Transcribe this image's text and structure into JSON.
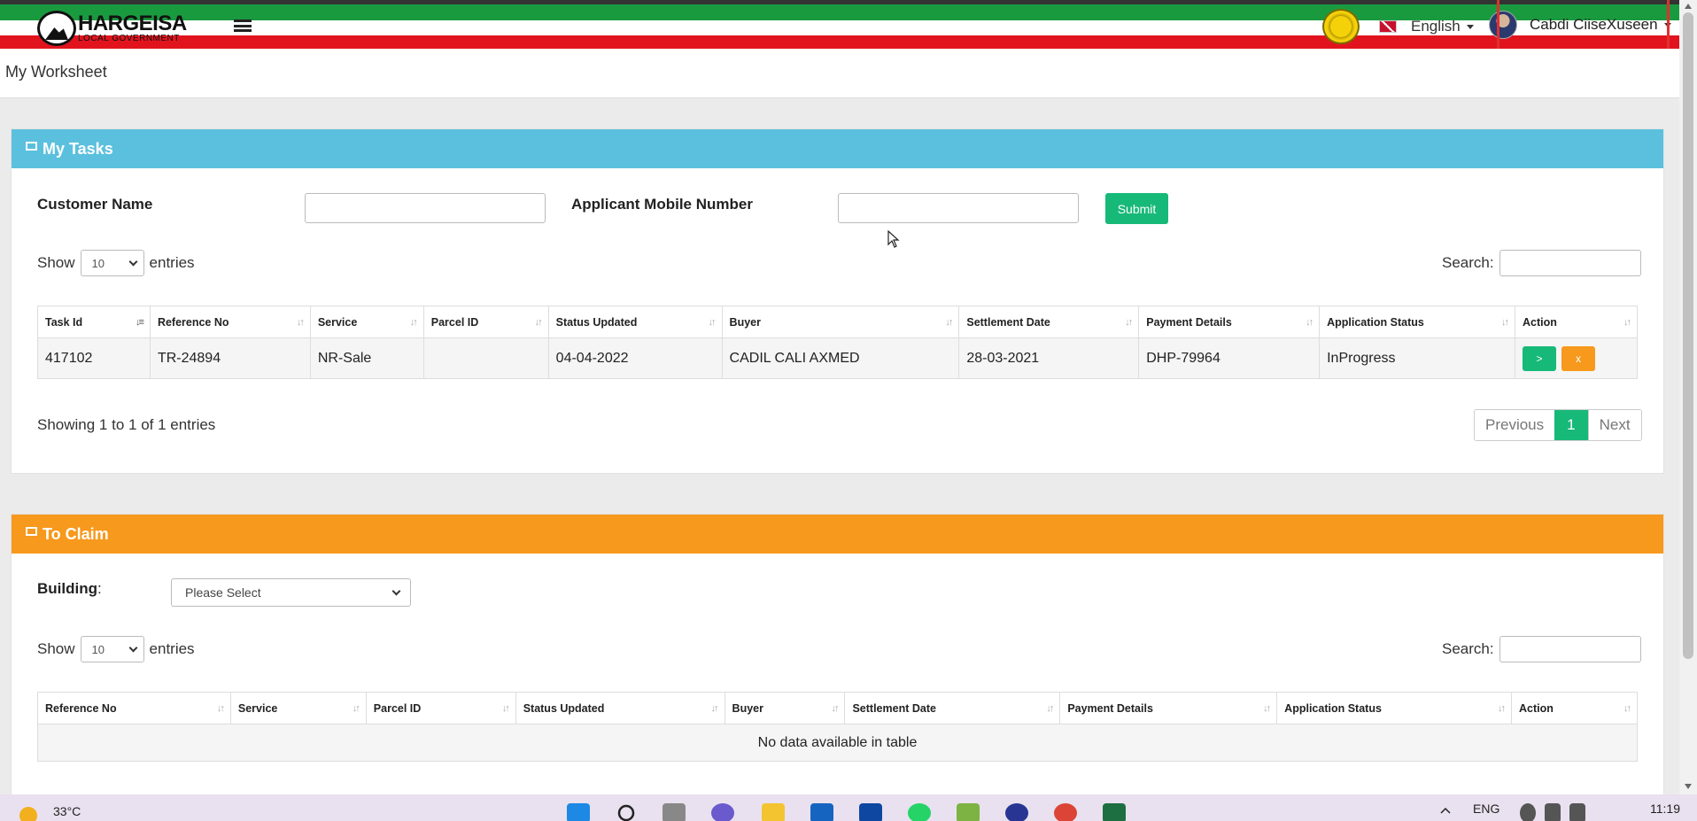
{
  "header": {
    "logo_title": "HARGEISA",
    "logo_subtitle": "LOCAL GOVERNMENT",
    "language": "English",
    "user_name": "Cabdi CiiseXuseen"
  },
  "page": {
    "title": "My Worksheet"
  },
  "my_tasks": {
    "heading": "My Tasks",
    "customer_name_label": "Customer Name",
    "mobile_label": "Applicant Mobile Number",
    "submit_label": "Submit",
    "show_label": "Show",
    "entries_label": "entries",
    "page_size": "10",
    "search_label": "Search:",
    "columns": [
      "Task Id",
      "Reference No",
      "Service",
      "Parcel ID",
      "Status Updated",
      "Buyer",
      "Settlement Date",
      "Payment Details",
      "Application Status",
      "Action"
    ],
    "rows": [
      {
        "task_id": "417102",
        "reference_no": "TR-24894",
        "service": "NR-Sale",
        "parcel_id": "",
        "status_updated": "04-04-2022",
        "buyer": "CADIL CALI AXMED",
        "settlement_date": "28-03-2021",
        "payment_details": "DHP-79964",
        "application_status": "InProgress",
        "action_go": ">",
        "action_cancel": "x"
      }
    ],
    "info": "Showing 1 to 1 of 1 entries",
    "pager": {
      "previous": "Previous",
      "current": "1",
      "next": "Next"
    }
  },
  "to_claim": {
    "heading": "To Claim",
    "building_label": "Building",
    "building_colon": ":",
    "building_select": "Please Select",
    "show_label": "Show",
    "entries_label": "entries",
    "page_size": "10",
    "search_label": "Search:",
    "columns": [
      "Reference No",
      "Service",
      "Parcel ID",
      "Status Updated",
      "Buyer",
      "Settlement Date",
      "Payment Details",
      "Application Status",
      "Action"
    ],
    "empty_text": "No data available in table"
  },
  "taskbar": {
    "temperature": "33°C",
    "lang": "ENG",
    "time": "11:19"
  },
  "colors": {
    "panel_blue": "#5bc0de",
    "panel_orange": "#f7991c",
    "primary_green": "#17b978",
    "flag_green": "#1a9a3f",
    "flag_red": "#e1141e",
    "highlight_red": "#e0302f"
  }
}
